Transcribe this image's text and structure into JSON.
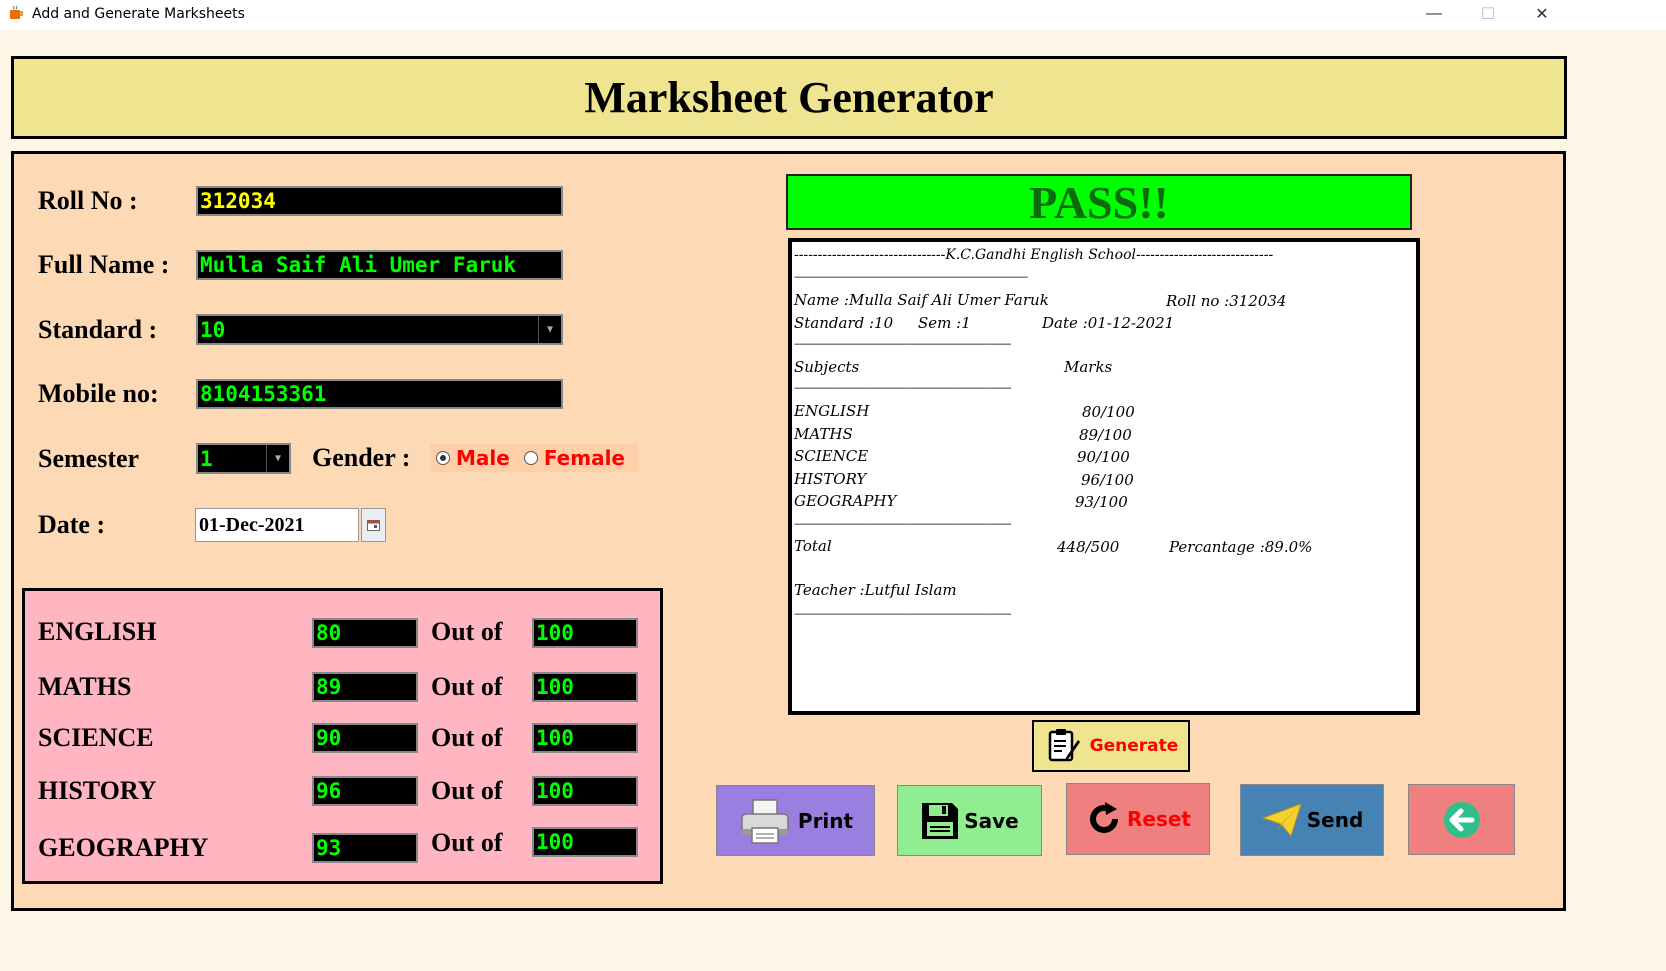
{
  "window": {
    "title": "Add and Generate Marksheets",
    "minimize": "—",
    "maximize": "☐",
    "close": "✕"
  },
  "header": {
    "title": "Marksheet Generator"
  },
  "form": {
    "roll_label": "Roll No :",
    "roll_value": "312034",
    "name_label": "Full Name :",
    "name_value": "Mulla Saif Ali Umer Faruk",
    "standard_label": "Standard :",
    "standard_value": "10",
    "mobile_label": "Mobile no:",
    "mobile_value": "8104153361",
    "semester_label": "Semester",
    "semester_value": "1",
    "gender_label": "Gender :",
    "gender_male": "Male",
    "gender_female": "Female",
    "gender_selected": "Male",
    "date_label": "Date :",
    "date_value": "01-Dec-2021"
  },
  "subjects": [
    {
      "name": "ENGLISH",
      "marks": "80",
      "outof_label": "Out of",
      "total": "100"
    },
    {
      "name": "MATHS",
      "marks": "89",
      "outof_label": "Out of",
      "total": "100"
    },
    {
      "name": "SCIENCE",
      "marks": "90",
      "outof_label": "Out of",
      "total": "100"
    },
    {
      "name": "HISTORY",
      "marks": "96",
      "outof_label": "Out of",
      "total": "100"
    },
    {
      "name": "GEOGRAPHY",
      "marks": "93",
      "outof_label": "Out of",
      "total": "100"
    }
  ],
  "result": {
    "status": "PASS!!"
  },
  "sheet": {
    "school_line": "--------------------------------K.C.Gandhi English School-----------------------------",
    "sep_full": "--------------------------------------------------------------------------------------------------",
    "name_line": "Name :Mulla Saif Ali Umer Faruk",
    "roll_line": "Roll no :312034",
    "standard_line": "Standard :10",
    "sem_line": "Sem :1",
    "date_line": "Date :01-12-2021",
    "sep": "-------------------------------------------------------------------------------------------",
    "subjects_header": "Subjects",
    "marks_header": "Marks",
    "rows": [
      {
        "subject": "ENGLISH",
        "marks": "80/100"
      },
      {
        "subject": "MATHS",
        "marks": "89/100"
      },
      {
        "subject": "SCIENCE",
        "marks": "90/100"
      },
      {
        "subject": "HISTORY",
        "marks": "96/100"
      },
      {
        "subject": "GEOGRAPHY",
        "marks": "93/100"
      }
    ],
    "total_label": "Total",
    "total_value": "448/500",
    "percentage": "Percantage :89.0%",
    "teacher": "Teacher :Lutful Islam"
  },
  "buttons": {
    "generate": "Generate",
    "print": "Print",
    "save": "Save",
    "reset": "Reset",
    "send": "Send"
  },
  "colors": {
    "header_bg": "#efe48f",
    "panel_bg": "#fdd9b5",
    "marks_bg": "#ffb6c1",
    "pass_bg": "#00ff00",
    "print_btn": "#9b7fe0",
    "save_btn": "#90ee90",
    "reset_btn": "#f08080",
    "send_btn": "#4682b4",
    "back_btn": "#f08080"
  },
  "icons": {
    "app": "java-icon",
    "generate": "document-edit-icon",
    "print": "printer-icon",
    "save": "floppy-disk-icon",
    "reset": "refresh-icon",
    "send": "paper-plane-icon",
    "back": "arrow-left-circle-icon",
    "calendar": "calendar-icon"
  }
}
